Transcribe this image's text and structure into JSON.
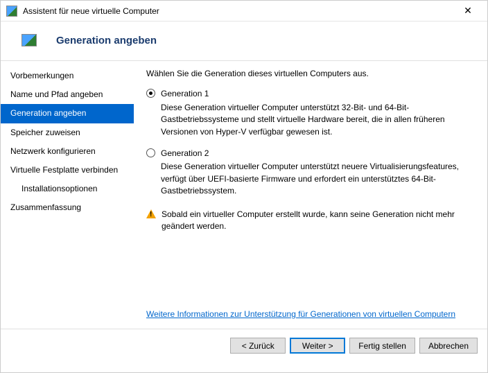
{
  "window": {
    "title": "Assistent für neue virtuelle Computer"
  },
  "header": {
    "title": "Generation angeben"
  },
  "sidebar": {
    "items": [
      {
        "label": "Vorbemerkungen"
      },
      {
        "label": "Name und Pfad angeben"
      },
      {
        "label": "Generation angeben"
      },
      {
        "label": "Speicher zuweisen"
      },
      {
        "label": "Netzwerk konfigurieren"
      },
      {
        "label": "Virtuelle Festplatte verbinden"
      },
      {
        "label": "Installationsoptionen"
      },
      {
        "label": "Zusammenfassung"
      }
    ]
  },
  "content": {
    "intro": "Wählen Sie die Generation dieses virtuellen Computers aus.",
    "gen1": {
      "label": "Generation 1",
      "desc": "Diese Generation virtueller Computer unterstützt 32-Bit- und 64-Bit-Gastbetriebssysteme und stellt virtuelle Hardware bereit, die in allen früheren Versionen von Hyper-V verfügbar gewesen ist."
    },
    "gen2": {
      "label": "Generation 2",
      "desc": "Diese Generation virtueller Computer unterstützt neuere Virtualisierungsfeatures, verfügt über UEFI-basierte Firmware und erfordert ein unterstütztes 64-Bit-Gastbetriebssystem."
    },
    "warning": "Sobald ein virtueller Computer erstellt wurde, kann seine Generation nicht mehr geändert werden.",
    "info_link": "Weitere Informationen zur Unterstützung für Generationen von virtuellen Computern"
  },
  "footer": {
    "back": "< Zurück",
    "next": "Weiter >",
    "finish": "Fertig stellen",
    "cancel": "Abbrechen"
  }
}
